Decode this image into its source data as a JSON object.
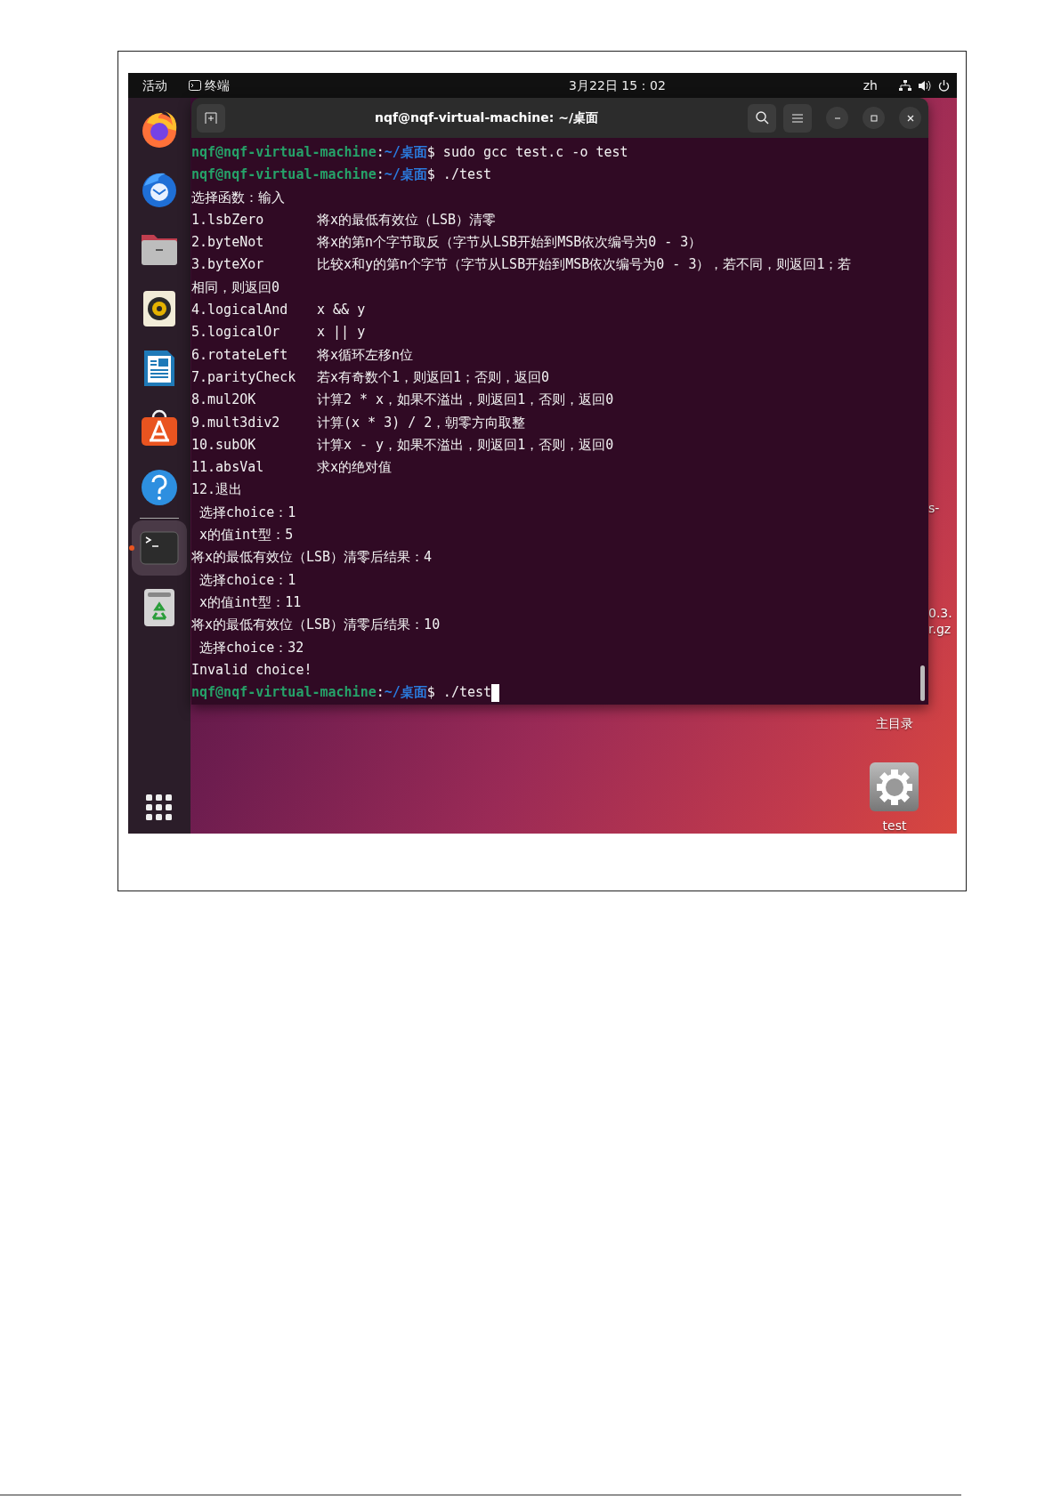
{
  "topbar": {
    "activities": "活动",
    "app": "终端",
    "clock": "3月22日 15：02",
    "language": "zh"
  },
  "dock": [
    {
      "kind": "browser",
      "selected": false
    },
    {
      "kind": "mail",
      "selected": false
    },
    {
      "kind": "files",
      "selected": false
    },
    {
      "kind": "speaker",
      "selected": false
    },
    {
      "kind": "document",
      "selected": false
    },
    {
      "kind": "store",
      "selected": false
    },
    {
      "kind": "help",
      "selected": false
    },
    {
      "kind": "terminal",
      "selected": true
    },
    {
      "kind": "trash",
      "selected": false
    }
  ],
  "terminal": {
    "title": "nqf@nqf-virtual-machine: ~/桌面",
    "lines": [
      {
        "kind": "prompt",
        "user": "nqf@nqf-virtual-machine",
        "sep": ":",
        "path": "~/桌面",
        "command": "$ sudo gcc test.c -o test",
        "cursor": false
      },
      {
        "kind": "prompt",
        "user": "nqf@nqf-virtual-machine",
        "sep": ":",
        "path": "~/桌面",
        "command": "$ ./test",
        "cursor": false
      },
      {
        "kind": "text",
        "text": "选择函数：输入"
      },
      {
        "kind": "option",
        "label": "1.lsbZero",
        "desc": "将x的最低有效位（LSB）清零"
      },
      {
        "kind": "option",
        "label": "2.byteNot",
        "desc": "将x的第n个字节取反（字节从LSB开始到MSB依次编号为0 - 3）"
      },
      {
        "kind": "option",
        "label": "3.byteXor",
        "desc": "比较x和y的第n个字节（字节从LSB开始到MSB依次编号为0 - 3），若不同，则返回1；若"
      },
      {
        "kind": "text",
        "text": "相同，则返回0"
      },
      {
        "kind": "option",
        "label": "4.logicalAnd",
        "desc": "x && y"
      },
      {
        "kind": "option",
        "label": "5.logicalOr",
        "desc": "x || y"
      },
      {
        "kind": "option",
        "label": "6.rotateLeft",
        "desc": "将x循环左移n位"
      },
      {
        "kind": "option",
        "label": "7.parityCheck",
        "desc": "若x有奇数个1，则返回1；否则，返回0"
      },
      {
        "kind": "option",
        "label": "8.mul2OK",
        "desc": "计算2 * x，如果不溢出，则返回1，否则，返回0"
      },
      {
        "kind": "option",
        "label": "9.mult3div2",
        "desc": "计算(x * 3) / 2，朝零方向取整"
      },
      {
        "kind": "option",
        "label": "10.subOK",
        "desc": "计算x - y，如果不溢出，则返回1，否则，返回0"
      },
      {
        "kind": "option",
        "label": "11.absVal",
        "desc": "求x的绝对值"
      },
      {
        "kind": "text",
        "text": "12.退出"
      },
      {
        "kind": "text",
        "text": " 选择choice：1"
      },
      {
        "kind": "text",
        "text": " x的值int型：5"
      },
      {
        "kind": "text",
        "text": "将x的最低有效位（LSB）清零后结果：4"
      },
      {
        "kind": "text",
        "text": " 选择choice：1"
      },
      {
        "kind": "text",
        "text": " x的值int型：11"
      },
      {
        "kind": "text",
        "text": "将x的最低有效位（LSB）清零后结果：10"
      },
      {
        "kind": "text",
        "text": " 选择choice：32"
      },
      {
        "kind": "text",
        "text": "Invalid choice!"
      },
      {
        "kind": "prompt",
        "user": "nqf@nqf-virtual-machine",
        "sep": ":",
        "path": "~/桌面",
        "command": "$ ./test",
        "cursor": true
      }
    ]
  },
  "desktop": {
    "icons": [
      {
        "kind": "covered",
        "label_lines": [
          "s-"
        ]
      },
      {
        "kind": "covered",
        "label_lines": [
          "0.3.",
          "r.gz"
        ]
      },
      {
        "kind": "covered",
        "label_lines": [
          "主目录"
        ]
      },
      {
        "kind": "gear",
        "label_lines": [
          "test"
        ]
      }
    ]
  }
}
